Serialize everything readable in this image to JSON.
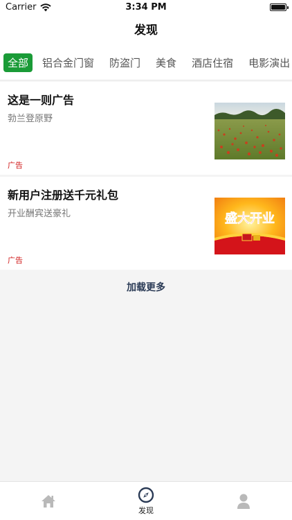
{
  "status_bar": {
    "carrier": "Carrier",
    "time": "3:34 PM"
  },
  "nav": {
    "title": "发现"
  },
  "tabs": [
    {
      "label": "全部",
      "active": true
    },
    {
      "label": "铝合金门窗",
      "active": false
    },
    {
      "label": "防盗门",
      "active": false
    },
    {
      "label": "美食",
      "active": false
    },
    {
      "label": "酒店住宿",
      "active": false
    },
    {
      "label": "电影演出",
      "active": false
    }
  ],
  "items": [
    {
      "title": "这是一则广告",
      "subtitle": "勃兰登原野",
      "tag": "广告",
      "image": "poppy-field-photo"
    },
    {
      "title": "新用户注册送千元礼包",
      "subtitle": "开业酬宾送豪礼",
      "tag": "广告",
      "image": "grand-opening-banner",
      "image_text": "盛大开业"
    }
  ],
  "load_more": "加载更多",
  "tab_bar": [
    {
      "icon": "home-icon",
      "label": "",
      "active": false
    },
    {
      "icon": "compass-icon",
      "label": "发现",
      "active": true
    },
    {
      "icon": "user-icon",
      "label": "",
      "active": false
    }
  ],
  "colors": {
    "accent": "#1a9b37",
    "ad_tag": "#d01818"
  }
}
